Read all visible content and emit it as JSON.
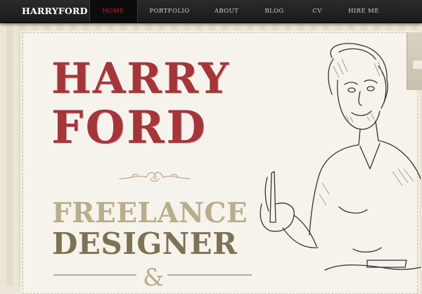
{
  "site": {
    "logo": "HARRYFORD"
  },
  "nav": {
    "items": [
      {
        "label": "HOME",
        "active": true
      },
      {
        "label": "PORTFOLIO",
        "active": false
      },
      {
        "label": "ABOUT",
        "active": false
      },
      {
        "label": "BLOG",
        "active": false
      },
      {
        "label": "CV",
        "active": false
      },
      {
        "label": "HIRE ME",
        "active": false
      }
    ]
  },
  "hero": {
    "name_line1": "HARRY",
    "name_line2": "FORD",
    "tagline_line1": "FREELANCE",
    "tagline_line2": "DESIGNER",
    "ampersand": "&"
  },
  "colors": {
    "nav_bg": "#1f1f1f",
    "nav_active_text": "#c4222a",
    "name_red": "#a5353a",
    "freelance_tan": "#b8ad8c",
    "designer_brown": "#7d7256",
    "paper": "#f6f3ec"
  }
}
